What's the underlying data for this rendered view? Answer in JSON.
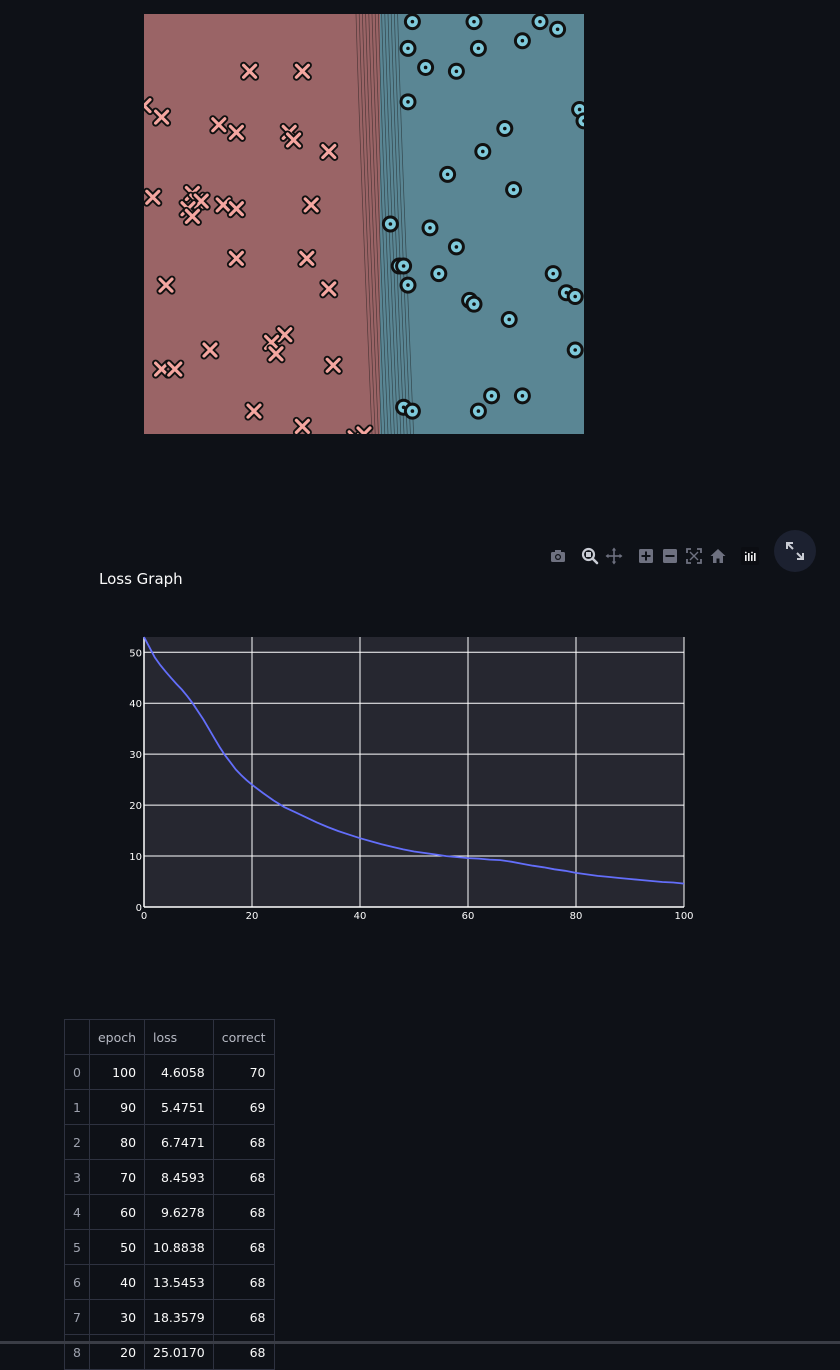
{
  "colors": {
    "background": "#0e1117",
    "region_class_x": "#9a6466",
    "region_class_o": "#5a8694",
    "marker_x_fill": "#f4a6a0",
    "marker_o_fill": "#7fcadb",
    "marker_stroke": "#111111",
    "loss_line": "#636efa",
    "plot_bg": "#262730",
    "grid": "#ffffff"
  },
  "boundary_plot": {
    "class_x_points": [
      [
        24,
        85
      ],
      [
        36,
        85
      ],
      [
        0,
        76
      ],
      [
        4,
        73
      ],
      [
        17,
        71
      ],
      [
        21,
        69
      ],
      [
        33,
        69
      ],
      [
        34,
        67
      ],
      [
        42,
        64
      ],
      [
        2,
        52
      ],
      [
        11,
        53
      ],
      [
        12,
        51
      ],
      [
        13,
        51
      ],
      [
        18,
        50
      ],
      [
        10,
        49
      ],
      [
        21,
        49
      ],
      [
        38,
        50
      ],
      [
        11,
        47
      ],
      [
        21,
        36
      ],
      [
        37,
        36
      ],
      [
        5,
        29
      ],
      [
        42,
        28
      ],
      [
        32,
        16
      ],
      [
        29,
        14
      ],
      [
        15,
        12
      ],
      [
        30,
        11
      ],
      [
        4,
        7
      ],
      [
        7,
        7
      ],
      [
        43,
        8
      ],
      [
        25,
        -4
      ],
      [
        36,
        -8
      ],
      [
        48,
        -11
      ],
      [
        50,
        -10
      ]
    ],
    "class_o_points": [
      [
        61,
        98
      ],
      [
        75,
        98
      ],
      [
        90,
        98
      ],
      [
        94,
        96
      ],
      [
        86,
        93
      ],
      [
        60,
        91
      ],
      [
        76,
        91
      ],
      [
        64,
        86
      ],
      [
        71,
        85
      ],
      [
        60,
        77
      ],
      [
        99,
        75
      ],
      [
        100,
        72
      ],
      [
        82,
        70
      ],
      [
        77,
        64
      ],
      [
        69,
        58
      ],
      [
        84,
        54
      ],
      [
        56,
        45
      ],
      [
        65,
        44
      ],
      [
        71,
        39
      ],
      [
        58,
        34
      ],
      [
        59,
        34
      ],
      [
        67,
        32
      ],
      [
        93,
        32
      ],
      [
        96,
        27
      ],
      [
        98,
        26
      ],
      [
        60,
        29
      ],
      [
        74,
        25
      ],
      [
        75,
        24
      ],
      [
        83,
        20
      ],
      [
        98,
        12
      ],
      [
        79,
        0
      ],
      [
        86,
        0
      ],
      [
        59,
        -3
      ],
      [
        76,
        -4
      ],
      [
        61,
        -4
      ]
    ],
    "x_range": [
      0,
      100
    ],
    "y_range": [
      -10,
      100
    ]
  },
  "modebar": {
    "items": [
      "camera-icon",
      "zoom-icon",
      "pan-icon",
      "zoom-in-icon",
      "zoom-out-icon",
      "autoscale-icon",
      "home-icon",
      "plotly-logo-icon"
    ],
    "expand_icon": "expand-icon"
  },
  "loss_graph": {
    "title": "Loss Graph",
    "chart_data": {
      "type": "line",
      "title": "",
      "xlabel": "",
      "ylabel": "",
      "xlim": [
        0,
        100
      ],
      "ylim": [
        0,
        53
      ],
      "x_ticks": [
        0,
        20,
        40,
        60,
        80,
        100
      ],
      "y_ticks": [
        0,
        10,
        20,
        30,
        40,
        50
      ],
      "grid": true,
      "series": [
        {
          "color": "#636efa",
          "x": [
            0,
            1,
            2,
            3,
            4,
            5,
            6,
            7,
            8,
            9,
            10,
            11,
            12,
            13,
            14,
            15,
            16,
            17,
            18,
            19,
            20,
            22,
            24,
            26,
            28,
            30,
            32,
            34,
            36,
            38,
            40,
            42,
            44,
            46,
            48,
            50,
            52,
            54,
            56,
            58,
            60,
            62,
            64,
            66,
            68,
            70,
            72,
            74,
            76,
            78,
            80,
            82,
            84,
            86,
            88,
            90,
            92,
            94,
            96,
            98,
            100
          ],
          "y": [
            53.0,
            51.0,
            49.0,
            47.5,
            46.2,
            45.0,
            43.8,
            42.7,
            41.4,
            40.0,
            38.4,
            36.8,
            35.0,
            33.2,
            31.4,
            29.8,
            28.4,
            27.0,
            25.9,
            24.9,
            24.0,
            22.4,
            20.9,
            19.6,
            18.6,
            17.6,
            16.6,
            15.7,
            14.9,
            14.2,
            13.5,
            12.9,
            12.3,
            11.8,
            11.3,
            10.9,
            10.6,
            10.3,
            10.0,
            9.8,
            9.6,
            9.5,
            9.3,
            9.2,
            8.9,
            8.5,
            8.1,
            7.8,
            7.4,
            7.1,
            6.7,
            6.4,
            6.1,
            5.9,
            5.7,
            5.5,
            5.3,
            5.1,
            4.9,
            4.8,
            4.6
          ]
        }
      ]
    }
  },
  "table": {
    "columns": [
      "",
      "epoch",
      "loss",
      "correct"
    ],
    "rows": [
      [
        "0",
        "100",
        "4.6058",
        "70"
      ],
      [
        "1",
        "90",
        "5.4751",
        "69"
      ],
      [
        "2",
        "80",
        "6.7471",
        "68"
      ],
      [
        "3",
        "70",
        "8.4593",
        "68"
      ],
      [
        "4",
        "60",
        "9.6278",
        "68"
      ],
      [
        "5",
        "50",
        "10.8838",
        "68"
      ],
      [
        "6",
        "40",
        "13.5453",
        "68"
      ],
      [
        "7",
        "30",
        "18.3579",
        "68"
      ],
      [
        "8",
        "20",
        "25.0170",
        "68"
      ]
    ]
  }
}
